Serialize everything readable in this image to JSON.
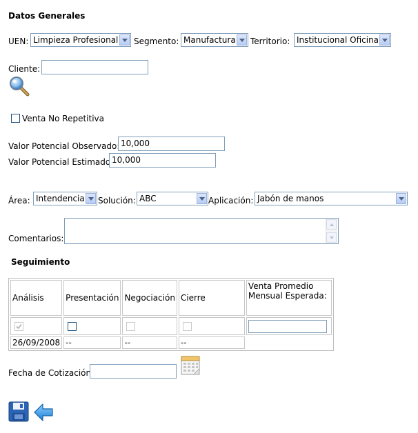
{
  "section_title": "Datos Generales",
  "uen": {
    "label": "UEN:",
    "value": "Limpieza Profesional"
  },
  "segmento": {
    "label": "Segmento:",
    "value": "Manufactura"
  },
  "territorio": {
    "label": "Territorio:",
    "value": "Institucional Oficina"
  },
  "cliente": {
    "label": "Cliente:",
    "value": "",
    "search_icon": "search-icon"
  },
  "venta_no_repetitiva": {
    "label": "Venta No Repetitiva",
    "checked": false
  },
  "valor_observado": {
    "label": "Valor Potencial Observado:",
    "value": "10,000"
  },
  "valor_estimado": {
    "label": "Valor Potencial Estimado:",
    "value": "10,000"
  },
  "area": {
    "label": "Área:",
    "value": "Intendencia"
  },
  "solucion": {
    "label": "Solución:",
    "value": "ABC"
  },
  "aplicacion": {
    "label": "Aplicación:",
    "value": "Jabón de manos"
  },
  "comentarios": {
    "label": "Comentarios:",
    "value": ""
  },
  "seguimiento": {
    "title": "Seguimiento",
    "headers": [
      "Análisis",
      "Presentación",
      "Negociación",
      "Cierre",
      "Venta Promedio Mensual Esperada:"
    ],
    "checks": [
      true,
      false,
      false,
      false
    ],
    "dates": [
      "26/09/2008",
      "--",
      "--",
      "--"
    ],
    "venta_value": ""
  },
  "fecha_cotizacion": {
    "label": "Fecha de Cotización",
    "value": "",
    "icon": "calendar-icon"
  },
  "actions": {
    "save_icon": "save-icon",
    "back_icon": "back-arrow-icon"
  }
}
